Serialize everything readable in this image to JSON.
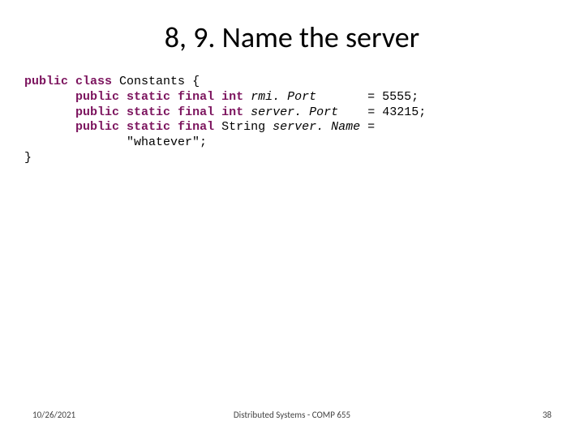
{
  "title": "8, 9. Name the server",
  "code": {
    "kw_public": "public",
    "kw_class": "class",
    "kw_static": "static",
    "kw_final": "final",
    "kw_int": "int",
    "className": " Constants {",
    "var_rmiPort": "rmi. Port",
    "val_rmiPort": "= 5555;",
    "var_serverPort": "server. Port",
    "val_serverPort": "= 43215;",
    "stringType": " String ",
    "var_serverName": "server. Name",
    "eq": " =",
    "literal": "\"whatever\";",
    "closeBrace": "}"
  },
  "footer": {
    "date": "10/26/2021",
    "center": "Distributed Systems - COMP 655",
    "page": "38"
  }
}
